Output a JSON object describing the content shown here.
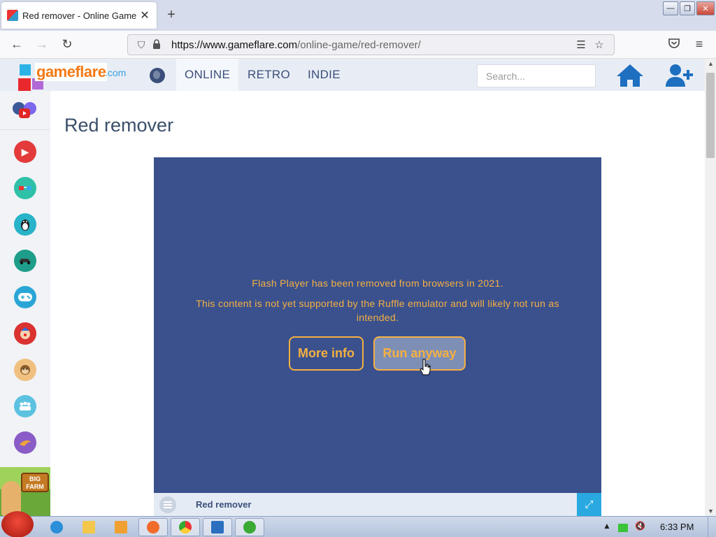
{
  "browser": {
    "tab_title": "Red remover - Online Game",
    "tab_close": "✕",
    "new_tab": "+",
    "url_domain": "https://www.gameflare.com",
    "url_path": "/online-game/red-remover/",
    "window_controls": {
      "minimize": "—",
      "maximize": "❐",
      "close": "✕"
    }
  },
  "site": {
    "logo_text": "gameflare",
    "logo_tld": ".com",
    "nav": [
      {
        "label": "ONLINE",
        "active": true
      },
      {
        "label": "RETRO",
        "active": false
      },
      {
        "label": "INDIE",
        "active": false
      }
    ],
    "search_placeholder": "Search...",
    "icons": [
      "globe-icon",
      "home-icon",
      "add-user-icon"
    ]
  },
  "sidebar": {
    "categories": [
      {
        "icon": "play-icon",
        "color": "#e33b3b"
      },
      {
        "icon": "3d-glasses-icon",
        "color": "#2ec1a8"
      },
      {
        "icon": "penguin-icon",
        "color": "#27b3c8"
      },
      {
        "icon": "car-icon",
        "color": "#1e9e8a"
      },
      {
        "icon": "gamepad-icon",
        "color": "#2aa6d6"
      },
      {
        "icon": "clown-icon",
        "color": "#d9322f"
      },
      {
        "icon": "monkey-icon",
        "color": "#f0c080"
      },
      {
        "icon": "people-icon",
        "color": "#5cc2e0"
      },
      {
        "icon": "bird-icon",
        "color": "#8a5cc7"
      }
    ],
    "ad_text": "BIG FARM"
  },
  "main": {
    "title": "Red remover",
    "ruffle_message_1": "Flash Player has been removed from browsers in 2021.",
    "ruffle_message_2": "This content is not yet supported by the Ruffle emulator and will likely not run as intended.",
    "more_info_label": "More info",
    "run_anyway_label": "Run anyway",
    "game_bar_title": "Red remover",
    "fullscreen_label": "⤢"
  },
  "taskbar": {
    "clock": "6:33 PM"
  },
  "colors": {
    "game_bg": "#3a518e",
    "ruffle_text": "#f6b042",
    "nav_text": "#3b4f7a",
    "logo_orange": "#f47a16"
  }
}
